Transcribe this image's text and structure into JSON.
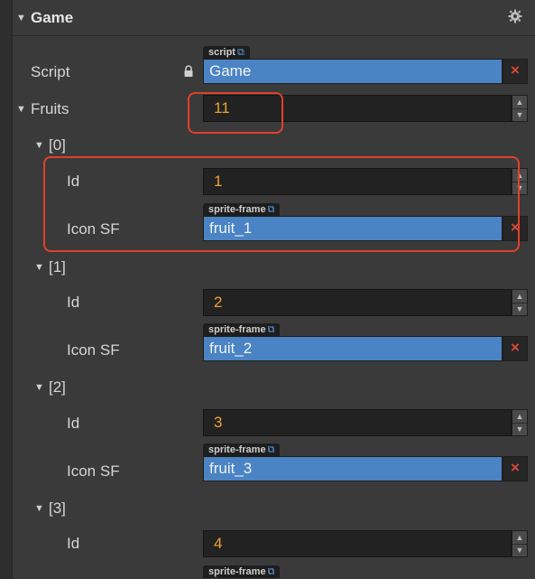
{
  "component": {
    "title": "Game"
  },
  "script": {
    "label": "Script",
    "tag": "script",
    "value": "Game"
  },
  "fruits": {
    "label": "Fruits",
    "count": "11",
    "items": [
      {
        "index": "[0]",
        "id_label": "Id",
        "id": "1",
        "icon_label": "Icon SF",
        "tag": "sprite-frame",
        "icon": "fruit_1"
      },
      {
        "index": "[1]",
        "id_label": "Id",
        "id": "2",
        "icon_label": "Icon SF",
        "tag": "sprite-frame",
        "icon": "fruit_2"
      },
      {
        "index": "[2]",
        "id_label": "Id",
        "id": "3",
        "icon_label": "Icon SF",
        "tag": "sprite-frame",
        "icon": "fruit_3"
      },
      {
        "index": "[3]",
        "id_label": "Id",
        "id": "4",
        "tag": "sprite-frame"
      }
    ]
  },
  "icons": {
    "gear": "gear-icon",
    "lock": "lock-icon",
    "remove": "close-icon",
    "external": "external-link-icon"
  },
  "colors": {
    "accent": "#4a84c4",
    "number": "#f0a030",
    "remove": "#d84a3a",
    "highlight": "#e0402a"
  }
}
